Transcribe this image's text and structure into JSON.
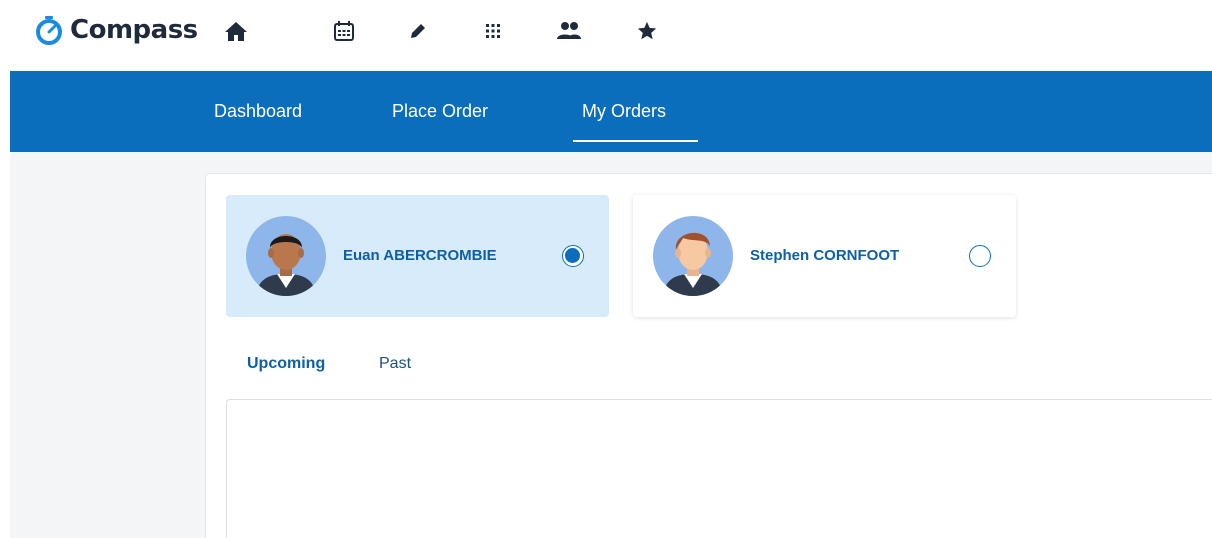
{
  "app": {
    "name": "Compass",
    "brand_color": "#0a6ebd"
  },
  "topbar": {
    "icons": [
      "home-icon",
      "calendar-icon",
      "pencil-icon",
      "grid-icon",
      "people-icon",
      "star-icon"
    ]
  },
  "nav": {
    "items": [
      {
        "label": "Dashboard"
      },
      {
        "label": "Place Order"
      },
      {
        "label": "My Orders",
        "active": true
      }
    ]
  },
  "students": [
    {
      "name": "Euan ABERCROMBIE",
      "selected": true
    },
    {
      "name": "Stephen CORNFOOT",
      "selected": false
    }
  ],
  "tabs": [
    {
      "label": "Upcoming",
      "active": true
    },
    {
      "label": "Past",
      "active": false
    }
  ]
}
